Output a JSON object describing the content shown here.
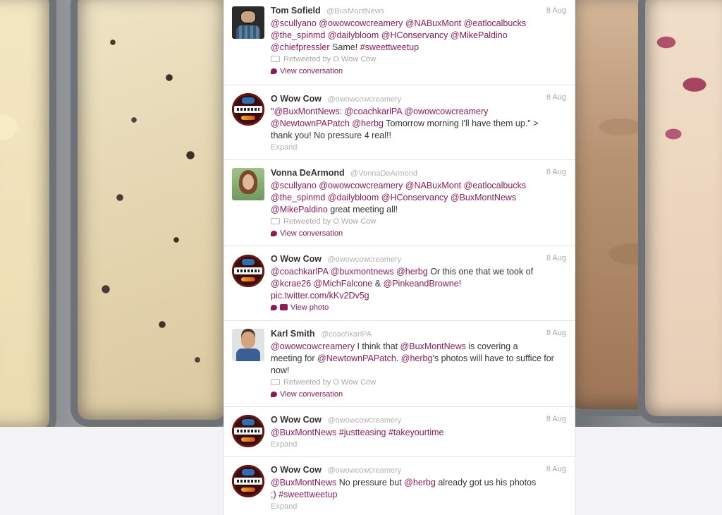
{
  "timeline": {
    "tweets": [
      {
        "fullname": "Tom Sofield",
        "username": "@BuxMontNews",
        "time": "8 Aug",
        "text_lines": [
          [
            [
              "m",
              "@scullyano"
            ],
            [
              "t",
              " "
            ],
            [
              "m",
              "@owowcowcreamery"
            ],
            [
              "t",
              " "
            ],
            [
              "m",
              "@NABuxMont"
            ],
            [
              "t",
              " "
            ],
            [
              "m",
              "@eatlocalbucks"
            ]
          ],
          [
            [
              "m",
              "@the_spinmd"
            ],
            [
              "t",
              " "
            ],
            [
              "m",
              "@dailybloom"
            ],
            [
              "t",
              " "
            ],
            [
              "m",
              "@HConservancy"
            ],
            [
              "t",
              " "
            ],
            [
              "m",
              "@MikePaldino"
            ]
          ],
          [
            [
              "m",
              "@chiefpressler"
            ],
            [
              "t",
              " Same! "
            ],
            [
              "m",
              "#sweettweetup"
            ]
          ]
        ],
        "retweeted_by": "Retweeted by O Wow Cow",
        "action": "View conversation"
      },
      {
        "fullname": "O Wow Cow",
        "username": "@owowcowcreamery",
        "time": "8 Aug",
        "text_lines": [
          [
            [
              "t",
              "\""
            ],
            [
              "m",
              "@BuxMontNews"
            ],
            [
              "t",
              ": "
            ],
            [
              "m",
              "@coachkarlPA"
            ],
            [
              "t",
              " "
            ],
            [
              "m",
              "@owowcowcreamery"
            ]
          ],
          [
            [
              "m",
              "@NewtownPAPatch"
            ],
            [
              "t",
              " "
            ],
            [
              "m",
              "@herbg"
            ],
            [
              "t",
              " Tomorrow morning I'll have them up.\" >"
            ]
          ],
          [
            [
              "t",
              "thank you! No pressure 4 real!!"
            ]
          ]
        ],
        "expand": "Expand"
      },
      {
        "fullname": "Vonna DeArmond",
        "username": "@VonnaDeArmond",
        "time": "8 Aug",
        "text_lines": [
          [
            [
              "m",
              "@scullyano"
            ],
            [
              "t",
              " "
            ],
            [
              "m",
              "@owowcowcreamery"
            ],
            [
              "t",
              " "
            ],
            [
              "m",
              "@NABuxMont"
            ],
            [
              "t",
              " "
            ],
            [
              "m",
              "@eatlocalbucks"
            ]
          ],
          [
            [
              "m",
              "@the_spinmd"
            ],
            [
              "t",
              " "
            ],
            [
              "m",
              "@dailybloom"
            ],
            [
              "t",
              " "
            ],
            [
              "m",
              "@HConservancy"
            ],
            [
              "t",
              " "
            ],
            [
              "m",
              "@BuxMontNews"
            ]
          ],
          [
            [
              "m",
              "@MikePaldino"
            ],
            [
              "t",
              " great meeting all!"
            ]
          ]
        ],
        "retweeted_by": "Retweeted by O Wow Cow",
        "action": "View conversation"
      },
      {
        "fullname": "O Wow Cow",
        "username": "@owowcowcreamery",
        "time": "8 Aug",
        "text_lines": [
          [
            [
              "m",
              "@coachkarlPA"
            ],
            [
              "t",
              " "
            ],
            [
              "m",
              "@buxmontnews"
            ],
            [
              "t",
              " "
            ],
            [
              "m",
              "@herbg"
            ],
            [
              "t",
              " Or this one that we took of"
            ]
          ],
          [
            [
              "m",
              "@kcrae26"
            ],
            [
              "t",
              " "
            ],
            [
              "m",
              "@MichFalcone"
            ],
            [
              "t",
              " & "
            ],
            [
              "m",
              "@PinkeandBrowne"
            ],
            [
              "t",
              "!"
            ]
          ],
          [
            [
              "m",
              "pic.twitter.com/kKv2Dv5g"
            ]
          ]
        ],
        "action": "View photo"
      },
      {
        "fullname": "Karl Smith",
        "username": "@coachkarlPA",
        "time": "8 Aug",
        "text_lines": [
          [
            [
              "m",
              "@owowcowcreamery"
            ],
            [
              "t",
              " I think that "
            ],
            [
              "m",
              "@BuxMontNews"
            ],
            [
              "t",
              " is covering a"
            ]
          ],
          [
            [
              "t",
              "meeting for "
            ],
            [
              "m",
              "@NewtownPAPatch"
            ],
            [
              "t",
              ". "
            ],
            [
              "m",
              "@herbg"
            ],
            [
              "t",
              "'s photos will have to suffice for"
            ]
          ],
          [
            [
              "t",
              "now!"
            ]
          ]
        ],
        "retweeted_by": "Retweeted by O Wow Cow",
        "action": "View conversation"
      },
      {
        "fullname": "O Wow Cow",
        "username": "@owowcowcreamery",
        "time": "8 Aug",
        "text_lines": [
          [
            [
              "m",
              "@BuxMontNews"
            ],
            [
              "t",
              " "
            ],
            [
              "m",
              "#justteasing"
            ],
            [
              "t",
              " "
            ],
            [
              "m",
              "#takeyourtime"
            ]
          ]
        ],
        "expand": "Expand"
      },
      {
        "fullname": "O Wow Cow",
        "username": "@owowcowcreamery",
        "time": "8 Aug",
        "text_lines": [
          [
            [
              "m",
              "@BuxMontNews"
            ],
            [
              "t",
              " No pressure but "
            ],
            [
              "m",
              "@herbg"
            ],
            [
              "t",
              " already got us his photos"
            ]
          ],
          [
            [
              "t",
              ";) "
            ],
            [
              "m",
              "#sweettweetup"
            ]
          ]
        ],
        "expand": "Expand"
      }
    ]
  }
}
